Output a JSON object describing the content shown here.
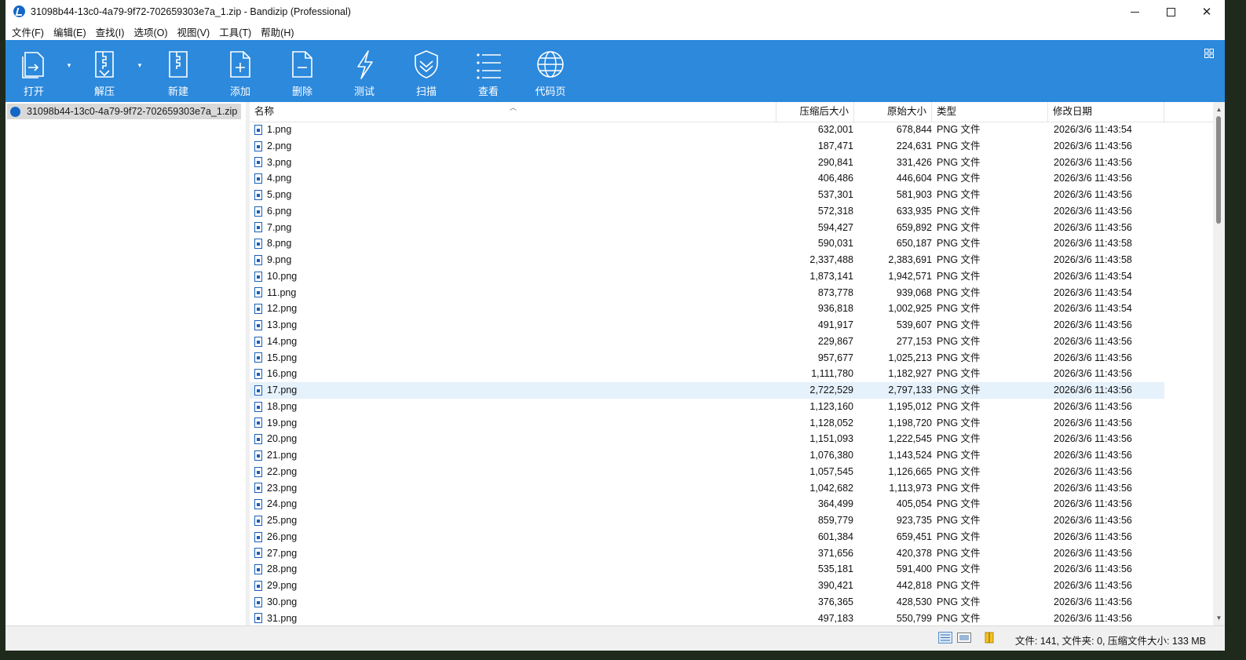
{
  "window": {
    "title": "31098b44-13c0-4a79-9f72-702659303e7a_1.zip - Bandizip (Professional)",
    "close_glyph": "✕"
  },
  "menu": [
    "文件(F)",
    "编辑(E)",
    "查找(I)",
    "选项(O)",
    "视图(V)",
    "工具(T)",
    "帮助(H)"
  ],
  "toolbar": {
    "background": "#2c89dc",
    "tools": [
      {
        "label": "打开",
        "icon": "open-icon"
      },
      {
        "label": "解压",
        "icon": "extract-icon"
      },
      {
        "label": "新建",
        "icon": "new-archive-icon"
      },
      {
        "label": "添加",
        "icon": "add-icon"
      },
      {
        "label": "删除",
        "icon": "delete-icon"
      },
      {
        "label": "测试",
        "icon": "test-icon"
      },
      {
        "label": "扫描",
        "icon": "scan-icon"
      },
      {
        "label": "查看",
        "icon": "view-icon"
      },
      {
        "label": "代码页",
        "icon": "codepage-icon"
      }
    ]
  },
  "tree": {
    "items": [
      {
        "label": "31098b44-13c0-4a79-9f72-702659303e7a_1.zip",
        "selected": true
      }
    ]
  },
  "list": {
    "columns": {
      "name": "名称",
      "packed": "压缩后大小",
      "size": "原始大小",
      "type": "类型",
      "modified": "修改日期"
    },
    "selected_index": 16,
    "rows": [
      {
        "name": "1.png",
        "packed": "632,001",
        "size": "678,844",
        "type": "PNG 文件",
        "modified": "2026/3/6 11:43:54"
      },
      {
        "name": "2.png",
        "packed": "187,471",
        "size": "224,631",
        "type": "PNG 文件",
        "modified": "2026/3/6 11:43:56"
      },
      {
        "name": "3.png",
        "packed": "290,841",
        "size": "331,426",
        "type": "PNG 文件",
        "modified": "2026/3/6 11:43:56"
      },
      {
        "name": "4.png",
        "packed": "406,486",
        "size": "446,604",
        "type": "PNG 文件",
        "modified": "2026/3/6 11:43:56"
      },
      {
        "name": "5.png",
        "packed": "537,301",
        "size": "581,903",
        "type": "PNG 文件",
        "modified": "2026/3/6 11:43:56"
      },
      {
        "name": "6.png",
        "packed": "572,318",
        "size": "633,935",
        "type": "PNG 文件",
        "modified": "2026/3/6 11:43:56"
      },
      {
        "name": "7.png",
        "packed": "594,427",
        "size": "659,892",
        "type": "PNG 文件",
        "modified": "2026/3/6 11:43:56"
      },
      {
        "name": "8.png",
        "packed": "590,031",
        "size": "650,187",
        "type": "PNG 文件",
        "modified": "2026/3/6 11:43:58"
      },
      {
        "name": "9.png",
        "packed": "2,337,488",
        "size": "2,383,691",
        "type": "PNG 文件",
        "modified": "2026/3/6 11:43:58"
      },
      {
        "name": "10.png",
        "packed": "1,873,141",
        "size": "1,942,571",
        "type": "PNG 文件",
        "modified": "2026/3/6 11:43:54"
      },
      {
        "name": "11.png",
        "packed": "873,778",
        "size": "939,068",
        "type": "PNG 文件",
        "modified": "2026/3/6 11:43:54"
      },
      {
        "name": "12.png",
        "packed": "936,818",
        "size": "1,002,925",
        "type": "PNG 文件",
        "modified": "2026/3/6 11:43:54"
      },
      {
        "name": "13.png",
        "packed": "491,917",
        "size": "539,607",
        "type": "PNG 文件",
        "modified": "2026/3/6 11:43:56"
      },
      {
        "name": "14.png",
        "packed": "229,867",
        "size": "277,153",
        "type": "PNG 文件",
        "modified": "2026/3/6 11:43:56"
      },
      {
        "name": "15.png",
        "packed": "957,677",
        "size": "1,025,213",
        "type": "PNG 文件",
        "modified": "2026/3/6 11:43:56"
      },
      {
        "name": "16.png",
        "packed": "1,111,780",
        "size": "1,182,927",
        "type": "PNG 文件",
        "modified": "2026/3/6 11:43:56"
      },
      {
        "name": "17.png",
        "packed": "2,722,529",
        "size": "2,797,133",
        "type": "PNG 文件",
        "modified": "2026/3/6 11:43:56"
      },
      {
        "name": "18.png",
        "packed": "1,123,160",
        "size": "1,195,012",
        "type": "PNG 文件",
        "modified": "2026/3/6 11:43:56"
      },
      {
        "name": "19.png",
        "packed": "1,128,052",
        "size": "1,198,720",
        "type": "PNG 文件",
        "modified": "2026/3/6 11:43:56"
      },
      {
        "name": "20.png",
        "packed": "1,151,093",
        "size": "1,222,545",
        "type": "PNG 文件",
        "modified": "2026/3/6 11:43:56"
      },
      {
        "name": "21.png",
        "packed": "1,076,380",
        "size": "1,143,524",
        "type": "PNG 文件",
        "modified": "2026/3/6 11:43:56"
      },
      {
        "name": "22.png",
        "packed": "1,057,545",
        "size": "1,126,665",
        "type": "PNG 文件",
        "modified": "2026/3/6 11:43:56"
      },
      {
        "name": "23.png",
        "packed": "1,042,682",
        "size": "1,113,973",
        "type": "PNG 文件",
        "modified": "2026/3/6 11:43:56"
      },
      {
        "name": "24.png",
        "packed": "364,499",
        "size": "405,054",
        "type": "PNG 文件",
        "modified": "2026/3/6 11:43:56"
      },
      {
        "name": "25.png",
        "packed": "859,779",
        "size": "923,735",
        "type": "PNG 文件",
        "modified": "2026/3/6 11:43:56"
      },
      {
        "name": "26.png",
        "packed": "601,384",
        "size": "659,451",
        "type": "PNG 文件",
        "modified": "2026/3/6 11:43:56"
      },
      {
        "name": "27.png",
        "packed": "371,656",
        "size": "420,378",
        "type": "PNG 文件",
        "modified": "2026/3/6 11:43:56"
      },
      {
        "name": "28.png",
        "packed": "535,181",
        "size": "591,400",
        "type": "PNG 文件",
        "modified": "2026/3/6 11:43:56"
      },
      {
        "name": "29.png",
        "packed": "390,421",
        "size": "442,818",
        "type": "PNG 文件",
        "modified": "2026/3/6 11:43:56"
      },
      {
        "name": "30.png",
        "packed": "376,365",
        "size": "428,530",
        "type": "PNG 文件",
        "modified": "2026/3/6 11:43:56"
      },
      {
        "name": "31.png",
        "packed": "497,183",
        "size": "550,799",
        "type": "PNG 文件",
        "modified": "2026/3/6 11:43:56"
      }
    ]
  },
  "status": {
    "text": "文件: 141, 文件夹: 0, 压缩文件大小: 133 MB"
  }
}
